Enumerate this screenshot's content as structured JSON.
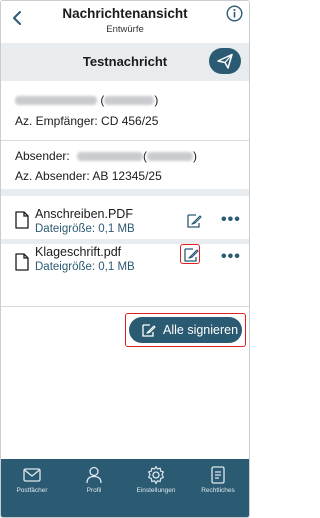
{
  "header": {
    "title": "Nachrichtenansicht",
    "subtitle": "Entwürfe"
  },
  "message": {
    "title": "Testnachricht"
  },
  "recipient": {
    "az_label": "Az. Empfänger: CD 456/25"
  },
  "sender": {
    "label": "Absender:",
    "az_label": "Az. Absender: AB 12345/25"
  },
  "documents": [
    {
      "name": "Anschreiben.PDF",
      "size": "Dateigröße: 0,1 MB"
    },
    {
      "name": "Klageschrift.pdf",
      "size": "Dateigröße: 0,1 MB"
    }
  ],
  "actions": {
    "sign_all_label": "Alle signieren",
    "more_label": "•••"
  },
  "nav": [
    {
      "label": "Postfächer",
      "icon": "mail-icon"
    },
    {
      "label": "Profil",
      "icon": "person-icon"
    },
    {
      "label": "Einstellungen",
      "icon": "gear-icon"
    },
    {
      "label": "Rechtliches",
      "icon": "document-icon"
    }
  ],
  "colors": {
    "accent": "#2b5a73",
    "bar_bg": "#e9ecef",
    "highlight": "#e02020"
  }
}
